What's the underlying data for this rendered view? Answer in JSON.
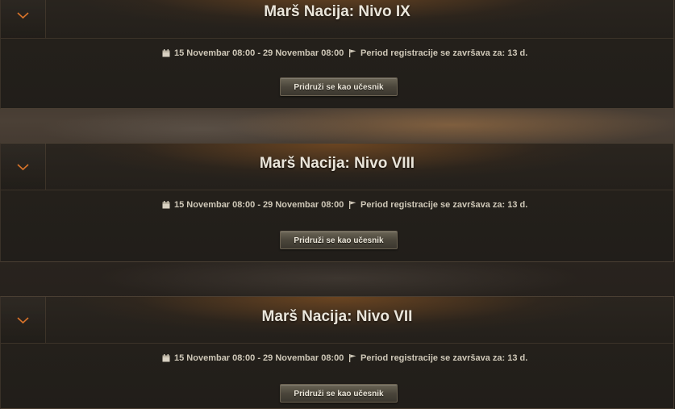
{
  "tournaments": [
    {
      "title": "Marš Nacija: Nivo IX",
      "dates": "15 Novembar 08:00 - 29 Novembar 08:00",
      "registration": "Period registracije se završava za: 13 d.",
      "join_label": "Pridruži se kao učesnik"
    },
    {
      "title": "Marš Nacija: Nivo VIII",
      "dates": "15 Novembar 08:00 - 29 Novembar 08:00",
      "registration": "Period registracije se završava za: 13 d.",
      "join_label": "Pridruži se kao učesnik"
    },
    {
      "title": "Marš Nacija: Nivo VII",
      "dates": "15 Novembar 08:00 - 29 Novembar 08:00",
      "registration": "Period registracije se završava za: 13 d.",
      "join_label": "Pridruži se kao učesnik"
    }
  ],
  "icons": {
    "toggle": "chevron-down-icon",
    "dates": "calendar-icon",
    "registration": "flag-icon"
  },
  "colors": {
    "accent_chevron": "#d9742a",
    "title_text": "#eae5da",
    "meta_text": "#cfc8b8"
  }
}
